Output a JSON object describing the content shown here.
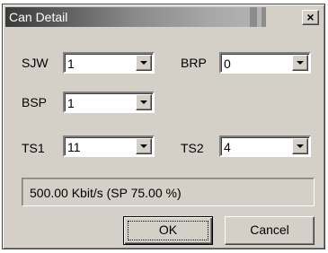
{
  "window": {
    "title": "Can Detail",
    "close_label": "×"
  },
  "fields": {
    "sjw": {
      "label": "SJW",
      "value": "1"
    },
    "brp": {
      "label": "BRP",
      "value": "0"
    },
    "bsp": {
      "label": "BSP",
      "value": "1"
    },
    "ts1": {
      "label": "TS1",
      "value": "11"
    },
    "ts2": {
      "label": "TS2",
      "value": "4"
    }
  },
  "status": {
    "text": "500.00 Kbit/s (SP 75.00 %)"
  },
  "buttons": {
    "ok_label": "OK",
    "cancel_label": "Cancel"
  }
}
